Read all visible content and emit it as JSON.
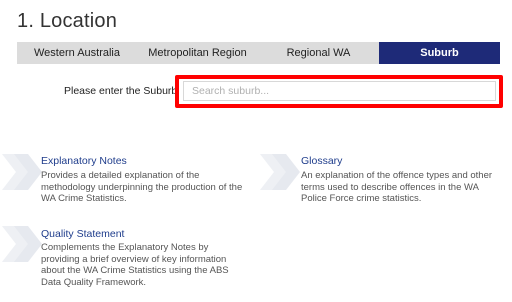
{
  "page": {
    "title": "1. Location"
  },
  "tabs": [
    {
      "label": "Western Australia",
      "active": false
    },
    {
      "label": "Metropolitan Region",
      "active": false
    },
    {
      "label": "Regional WA",
      "active": false
    },
    {
      "label": "Suburb",
      "active": true
    }
  ],
  "search": {
    "label": "Please enter the Suburb",
    "placeholder": "Search suburb...",
    "value": ""
  },
  "info": [
    {
      "title": "Explanatory Notes",
      "description": "Provides a detailed explanation of the methodology underpinning the production of the WA Crime Statistics."
    },
    {
      "title": "Glossary",
      "description": "An explanation of the offence types and other terms used to describe offences in the WA Police Force crime statistics."
    },
    {
      "title": "Quality Statement",
      "description": "Complements the Explanatory Notes by providing a brief overview of key information about the WA Crime Statistics using the ABS Data Quality Framework."
    }
  ],
  "colors": {
    "accent": "#1e2a78",
    "highlight": "#ff0000",
    "link": "#1f3d8c",
    "tab_bg": "#dcdcdc"
  }
}
